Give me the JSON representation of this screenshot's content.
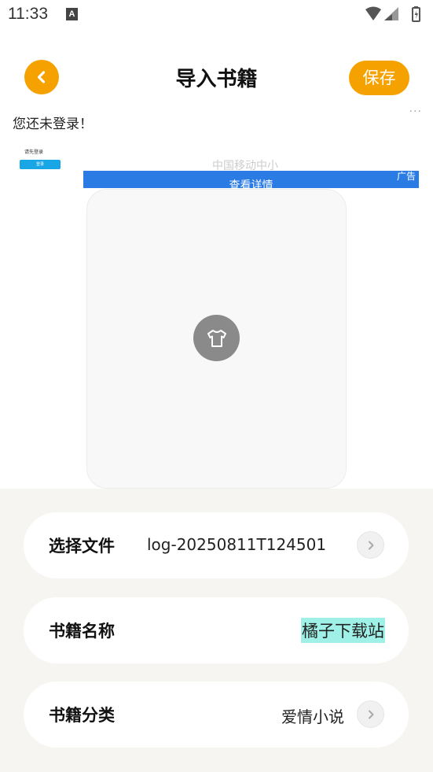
{
  "status_bar": {
    "time": "11:33",
    "notification_glyph": "A"
  },
  "header": {
    "title": "导入书籍",
    "save_label": "保存",
    "accent_color": "#f5a200"
  },
  "login_notice": "您还未登录！",
  "more_dots": "···",
  "ad": {
    "thumb_text": "请先登录",
    "thumb_button": "登录",
    "faint_text": "中国移动中小",
    "banner_text": "查看详情",
    "tag": "广告",
    "banner_color": "#2a7be4"
  },
  "form": {
    "file": {
      "label": "选择文件",
      "value": "log-20250811T124501"
    },
    "name": {
      "label": "书籍名称",
      "value": "橘子下载站"
    },
    "category": {
      "label": "书籍分类",
      "value": "爱情小说"
    }
  }
}
